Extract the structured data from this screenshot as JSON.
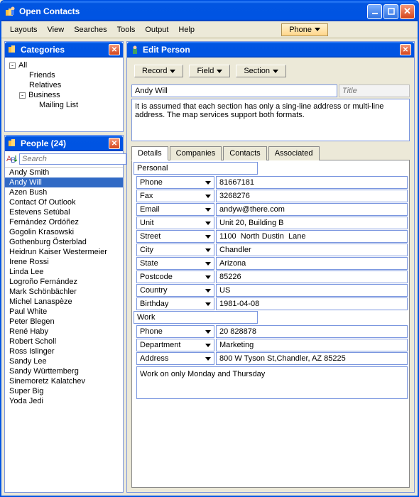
{
  "app": {
    "title": "Open Contacts"
  },
  "menu": {
    "layouts": "Layouts",
    "view": "View",
    "searches": "Searches",
    "tools": "Tools",
    "output": "Output",
    "help": "Help",
    "phone": "Phone"
  },
  "categories": {
    "title": "Categories",
    "all": "All",
    "friends": "Friends",
    "relatives": "Relatives",
    "business": "Business",
    "mailing": "Mailing List"
  },
  "people": {
    "title": "People  (24)",
    "search_placeholder": "Search",
    "list": [
      "Andy Smith",
      "Andy Will",
      "Azen Bush",
      "Contact Of Outlook",
      "Estevens Setúbal",
      "Fernández Ordóñez",
      "Gogolin Krasowski",
      "Gothenburg Österblad",
      "Heidrun Kaiser Westermeier",
      "Irene Rossi",
      "Linda Lee",
      "Logroño Fernández",
      "Mark Schönbächler",
      "Michel Lanaspèze",
      "Paul White",
      "Peter Blegen",
      "René Haby",
      "Robert Scholl",
      "Ross  Islinger",
      "Sandy Lee",
      "Sandy Württemberg",
      "Sinemoretz Kalatchev",
      "Super Big",
      "Yoda Jedi"
    ],
    "selected_index": 1
  },
  "edit": {
    "title": "Edit Person",
    "record": "Record",
    "field": "Field",
    "section": "Section",
    "name": "Andy Will",
    "title_placeholder": "Title",
    "notes": "It is assumed that each section has only a sing-line address or multi-line address. The map services support both formats.",
    "tabs": {
      "details": "Details",
      "companies": "Companies",
      "contacts": "Contacts",
      "associated": "Associated"
    },
    "personal": {
      "label": "Personal",
      "fields": [
        {
          "name": "Phone",
          "value": "81667181"
        },
        {
          "name": "Fax",
          "value": "3268276"
        },
        {
          "name": "Email",
          "value": "andyw@there.com"
        },
        {
          "name": "Unit",
          "value": "Unit 20, Building B"
        },
        {
          "name": "Street",
          "value": "1100  North Dustin  Lane"
        },
        {
          "name": "City",
          "value": "Chandler"
        },
        {
          "name": "State",
          "value": "Arizona"
        },
        {
          "name": "Postcode",
          "value": "85226"
        },
        {
          "name": "Country",
          "value": "US"
        },
        {
          "name": "Birthday",
          "value": "1981-04-08"
        }
      ]
    },
    "work": {
      "label": "Work",
      "fields": [
        {
          "name": "Phone",
          "value": "20 828878"
        },
        {
          "name": "Department",
          "value": "Marketing"
        },
        {
          "name": "Address",
          "value": "800 W Tyson St,Chandler, AZ 85225"
        }
      ],
      "notes": "Work on only Monday and Thursday"
    }
  }
}
